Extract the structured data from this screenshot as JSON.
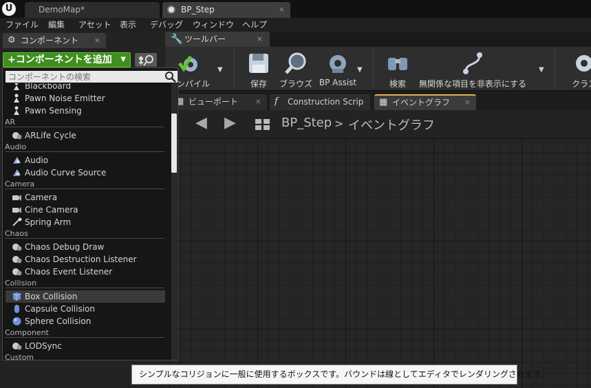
{
  "titlebar": {
    "logo": "U",
    "tabs": [
      {
        "label": "DemoMap*"
      },
      {
        "label": "BP_Step"
      }
    ],
    "close_glyph": "×"
  },
  "menu": [
    "ファイル",
    "編集",
    "アセット",
    "表示",
    "デバッグ",
    "ウィンドウ",
    "ヘルプ"
  ],
  "components_panel": {
    "tab_label": "コンポーネント",
    "add_button": "+コンポーネントを追加",
    "search_placeholder": "コンポーネントの検索"
  },
  "component_list": {
    "rows": [
      {
        "kind": "item",
        "label": "Blackboard",
        "icon": "pawn-icon"
      },
      {
        "kind": "item",
        "label": "Pawn Noise Emitter",
        "icon": "pawn-icon"
      },
      {
        "kind": "item",
        "label": "Pawn Sensing",
        "icon": "pawn-icon"
      },
      {
        "kind": "cat",
        "label": "AR"
      },
      {
        "kind": "item",
        "label": "ARLife Cycle",
        "icon": "component-icon"
      },
      {
        "kind": "cat",
        "label": "Audio"
      },
      {
        "kind": "item",
        "label": "Audio",
        "icon": "audio-icon"
      },
      {
        "kind": "item",
        "label": "Audio Curve Source",
        "icon": "audio-icon"
      },
      {
        "kind": "cat",
        "label": "Camera"
      },
      {
        "kind": "item",
        "label": "Camera",
        "icon": "camera-icon"
      },
      {
        "kind": "item",
        "label": "Cine Camera",
        "icon": "camera-icon"
      },
      {
        "kind": "item",
        "label": "Spring Arm",
        "icon": "spring-arm-icon"
      },
      {
        "kind": "cat",
        "label": "Chaos"
      },
      {
        "kind": "item",
        "label": "Chaos Debug Draw",
        "icon": "component-icon"
      },
      {
        "kind": "item",
        "label": "Chaos Destruction Listener",
        "icon": "component-icon"
      },
      {
        "kind": "item",
        "label": "Chaos Event Listener",
        "icon": "component-icon"
      },
      {
        "kind": "cat",
        "label": "Collision"
      },
      {
        "kind": "item",
        "label": "Box Collision",
        "icon": "box-collision-icon",
        "highlight": true
      },
      {
        "kind": "item",
        "label": "Capsule Collision",
        "icon": "capsule-collision-icon"
      },
      {
        "kind": "item",
        "label": "Sphere Collision",
        "icon": "sphere-collision-icon"
      },
      {
        "kind": "cat",
        "label": "Component"
      },
      {
        "kind": "item",
        "label": "LODSync",
        "icon": "component-icon"
      },
      {
        "kind": "cat",
        "label": "Custom"
      }
    ]
  },
  "toolbar": {
    "tab_label": "ツールバー",
    "buttons": [
      {
        "label": "コンパイル",
        "icon": "compile-gear-icon"
      },
      {
        "label": "保存",
        "icon": "save-disk-icon"
      },
      {
        "label": "ブラウズ",
        "icon": "browse-magnifier-icon"
      },
      {
        "label": "BP Assist",
        "icon": "bp-assist-gear-icon"
      },
      {
        "label": "検索",
        "icon": "find-binoculars-icon"
      },
      {
        "label": "無関係な項目を非表示にする",
        "icon": "hide-unrelated-icon"
      },
      {
        "label": "クラス",
        "icon": "class-settings-gear-icon"
      }
    ]
  },
  "graph_tabs": [
    {
      "label": "ビューポート",
      "icon": "viewport-icon"
    },
    {
      "label": "Construction Scrip",
      "icon": "function-icon"
    },
    {
      "label": "イベントグラフ",
      "icon": "event-graph-icon",
      "active": true
    }
  ],
  "graph_header": {
    "blueprint": "BP_Step",
    "separator": ">",
    "graph": "イベントグラフ",
    "back": "◀",
    "forward": "▶"
  },
  "tooltip": "シンプルなコリジョンに一般に使用するボックスです。バウンドは線としてエディタでレンダリングされます。",
  "colors": {
    "add_button_green": "#3e8f1f",
    "active_tab_accent": "#e2b34b",
    "graph_background": "#262626"
  }
}
